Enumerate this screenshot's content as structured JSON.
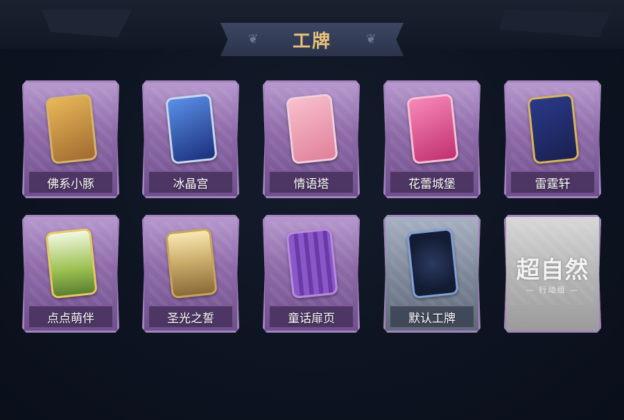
{
  "header": {
    "title": "工牌"
  },
  "cards": [
    {
      "label": "佛系小豚",
      "art_color": "#d9a548",
      "art_color2": "#8a5a2a",
      "style": "purple"
    },
    {
      "label": "冰晶宫",
      "art_color": "#3a6fd0",
      "art_color2": "#1a2f7a",
      "style": "purple"
    },
    {
      "label": "情语塔",
      "art_color": "#f0a6b8",
      "art_color2": "#c86b8a",
      "style": "purple"
    },
    {
      "label": "花蕾城堡",
      "art_color": "#f06aa0",
      "art_color2": "#b8306a",
      "style": "purple"
    },
    {
      "label": "雷霆轩",
      "art_color": "#2a3a8a",
      "art_color2": "#c9a545",
      "style": "purple"
    },
    {
      "label": "点点萌伴",
      "art_color": "#bcd878",
      "art_color2": "#6b8a30",
      "style": "purple"
    },
    {
      "label": "圣光之誓",
      "art_color": "#d8c08a",
      "art_color2": "#8a6a3a",
      "style": "purple"
    },
    {
      "label": "童话扉页",
      "art_color": "#7a48b8",
      "art_color2": "#4a2a7a",
      "style": "purple"
    },
    {
      "label": "默认工牌",
      "art_color": "#1e2a4a",
      "art_color2": "#0f1830",
      "style": "gray"
    },
    {
      "label": "",
      "logo": "超自然",
      "logo_sub": "— 行动组 —",
      "style": "silver"
    }
  ],
  "icons": {
    "banner_ornament": "swirl-ornament"
  }
}
